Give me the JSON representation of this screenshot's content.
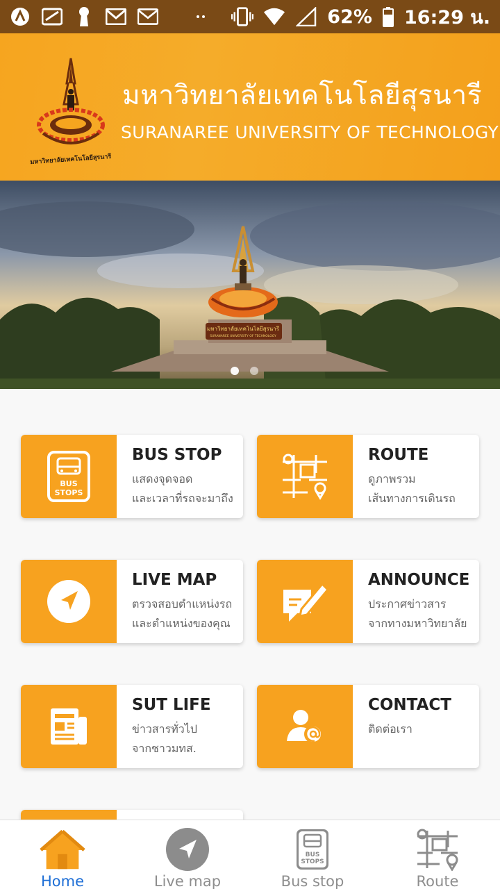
{
  "status_bar": {
    "battery": "62%",
    "time": "16:29 น.",
    "icons": [
      "app-icon",
      "sim-icon",
      "keyhole-icon",
      "gmail-icon",
      "gmail-icon",
      "dots-icon",
      "vibrate-icon",
      "wifi-icon",
      "signal-icon",
      "battery-icon"
    ]
  },
  "header": {
    "title_th": "มหาวิทยาลัยเทคโนโลยีสุรนารี",
    "title_en": "SURANAREE UNIVERSITY OF TECHNOLOGY",
    "logo_caption": "มหาวิทยาลัยเทคโนโลยีสุรนารี"
  },
  "hero": {
    "sign_text": "มหาวิทยาลัยเทคโนโลยีสุรนารี",
    "sign_sub": "SURANAREE UNIVERSITY OF TECHNOLOGY",
    "slide_count": 2,
    "active_slide": 1
  },
  "menu": [
    {
      "title": "BUS STOP",
      "line1": "แสดงจุดจอด",
      "line2": "และเวลาที่รถจะมาถึง",
      "icon": "bus-stop-icon",
      "icon_text1": "BUS",
      "icon_text2": "STOPS"
    },
    {
      "title": "ROUTE",
      "line1": "ดูภาพรวม",
      "line2": "เส้นทางการเดินรถ",
      "icon": "route-map-icon"
    },
    {
      "title": "LIVE MAP",
      "line1": "ตรวจสอบตำแหน่งรถ",
      "line2": "และตำแหน่งของคุณ",
      "icon": "navigation-arrow-icon"
    },
    {
      "title": "ANNOUNCE",
      "line1": "ประกาศข่าวสาร",
      "line2": "จากทางมหาวิทยาลัย",
      "icon": "edit-message-icon"
    },
    {
      "title": "SUT LIFE",
      "line1": "ข่าวสารทั่วไป",
      "line2": "จากชาวมทส.",
      "icon": "newspaper-icon"
    },
    {
      "title": "CONTACT",
      "line1": "ติดต่อเรา",
      "line2": "",
      "icon": "contact-person-icon"
    }
  ],
  "bottom_nav": [
    {
      "label": "Home",
      "icon": "home-icon",
      "active": true
    },
    {
      "label": "Live map",
      "icon": "navigation-arrow-icon",
      "active": false
    },
    {
      "label": "Bus stop",
      "icon": "bus-stop-icon",
      "active": false,
      "icon_text1": "BUS",
      "icon_text2": "STOPS"
    },
    {
      "label": "Route",
      "icon": "route-map-icon",
      "active": false
    }
  ],
  "colors": {
    "accent": "#f7a21f",
    "status_bar": "#7a4a16",
    "active_nav": "#1f6fd6",
    "inactive_nav": "#8e8e8e"
  }
}
